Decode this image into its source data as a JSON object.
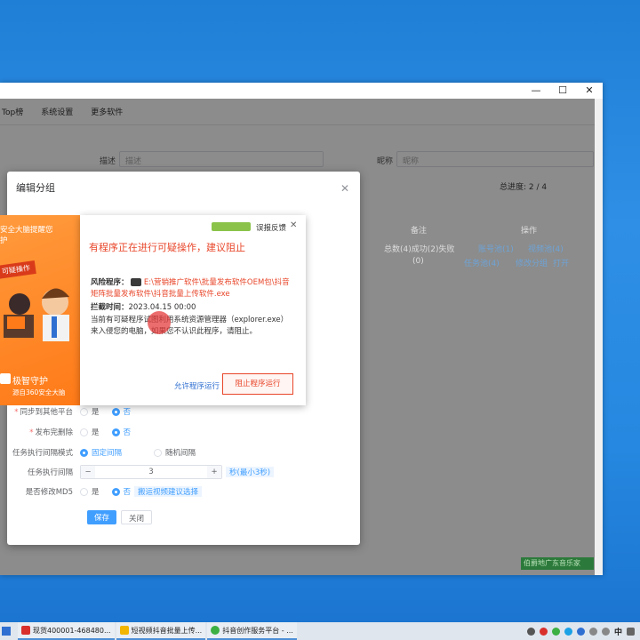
{
  "window": {
    "min": "—",
    "max": "☐",
    "close": "✕"
  },
  "menu": [
    "Top榜",
    "系统设置",
    "更多软件"
  ],
  "filters": {
    "desc_label": "描述",
    "desc_placeholder": "描述",
    "nick_label": "昵称",
    "nick_placeholder": "昵称"
  },
  "background": {
    "progress": "总进度: 2 / 4",
    "col_remark": "备注",
    "col_action": "操作",
    "row_summary": "总数(4)成功(2)失败",
    "row_zero": "(0)",
    "link_account_pool": "账号池(1)",
    "link_video_pool": "视频池(4)",
    "link_task_pool": "任务池(4)",
    "link_edit_group": "修改分组",
    "link_open": "打开",
    "open_btn": "打开",
    "status_strip": "伯爵地广东音乐家"
  },
  "dialog": {
    "title": "编辑分组",
    "close": "✕",
    "sync_label": "同步到其他平台",
    "delete_label": "发布完删除",
    "mode_label": "任务执行间隔模式",
    "mode_fixed": "固定间隔",
    "mode_random": "随机间隔",
    "interval_label": "任务执行间隔",
    "interval_value": "3",
    "interval_hint": "秒(最小3秒)",
    "md5_label": "是否修改MD5",
    "md5_hint": "搬运视频建议选择",
    "yes": "是",
    "no": "否",
    "save": "保存",
    "cancel": "关闭",
    "minus": "−",
    "plus": "+"
  },
  "orange_panel": {
    "line1": "安全大脑提醒您",
    "line2": "护",
    "badge": "可疑操作",
    "brand": "极智守护",
    "brand_sub": "源自360安全大脑"
  },
  "popup": {
    "feedback": "误报反馈",
    "close": "✕",
    "title": "有程序正在进行可疑操作，建议阻止",
    "risk_label": "风险程序：",
    "risk_path": "E:\\营销推广软件\\批量发布软件OEM包\\抖音矩阵批量发布软件\\抖音批量上传软件.exe",
    "time_label": "拦截时间：",
    "time_value": "2023.04.15 00:00",
    "desc": "当前有可疑程序试图利用系统资源管理器（explorer.exe）来入侵您的电脑，如果您不认识此程序，请阻止。",
    "allow": "允许程序运行",
    "block": "阻止程序运行"
  },
  "taskbar": {
    "items": [
      "现货400001-468480...",
      "短视频抖音批量上传...",
      "抖音创作服务平台 - ..."
    ],
    "ime": "中"
  },
  "colors": {
    "accent": "#409eff",
    "danger": "#e8462a",
    "orange": "#ff8a2a"
  }
}
